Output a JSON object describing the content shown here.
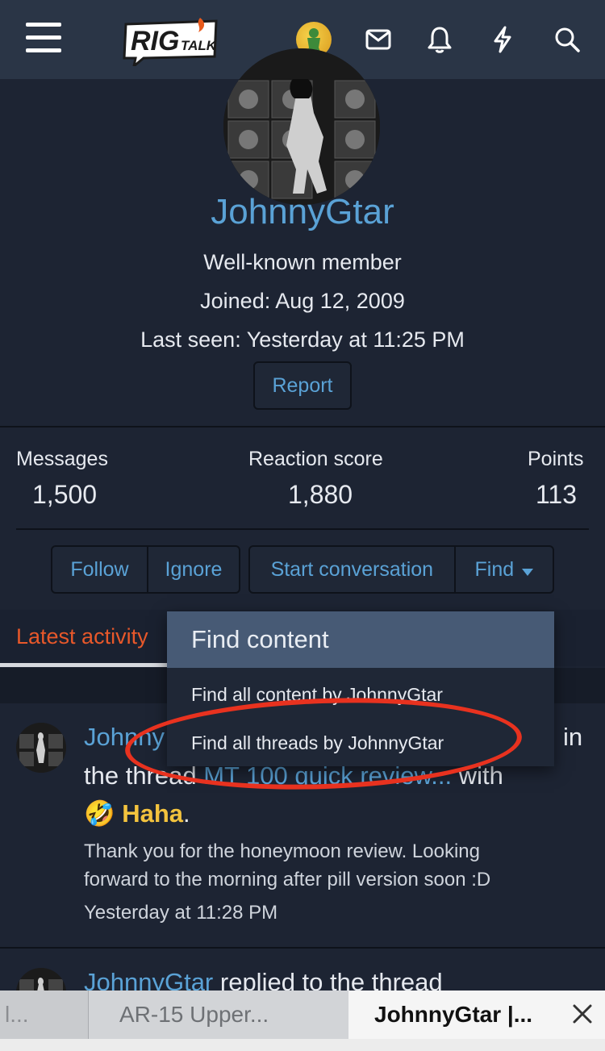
{
  "header": {
    "logo_text": "RIG TALK",
    "icons": [
      "menu-icon",
      "user-avatar",
      "mail-icon",
      "bell-icon",
      "lightning-icon",
      "search-icon"
    ]
  },
  "profile": {
    "username": "JohnnyGtar",
    "title": "Well-known member",
    "joined": "Joined: Aug 12, 2009",
    "last_seen": "Last seen: Yesterday at 11:25 PM",
    "report_label": "Report"
  },
  "stats": [
    {
      "label": "Messages",
      "value": "1,500"
    },
    {
      "label": "Reaction score",
      "value": "1,880"
    },
    {
      "label": "Points",
      "value": "113"
    }
  ],
  "actions": {
    "follow": "Follow",
    "ignore": "Ignore",
    "start_conversation": "Start conversation",
    "find": "Find"
  },
  "tabs": {
    "latest_activity": "Latest activity"
  },
  "dropdown": {
    "header": "Find content",
    "items": [
      "Find all content by JohnnyGtar",
      "Find all threads by JohnnyGtar"
    ]
  },
  "activity": [
    {
      "line1_user": "Johnny",
      "line1_tail": "in",
      "line2_prefix": "the thread ",
      "line2_link": "MT 100 quick review...",
      "line2_suffix": " with",
      "reaction_emoji": "🤣",
      "reaction": "Haha",
      "reaction_end": ".",
      "snippet_1": "Thank you for the honeymoon review. Looking",
      "snippet_2": "forward to the morning after pill version soon :D",
      "time": "Yesterday at 11:28 PM"
    },
    {
      "user": "JohnnyGtar",
      "text": " replied to the thread"
    }
  ],
  "browser_tabs": [
    {
      "label": "l..."
    },
    {
      "label": "AR-15 Upper..."
    },
    {
      "label": "JohnnyGtar |..."
    }
  ],
  "colors": {
    "background": "#1d2433",
    "header": "#2a3546",
    "link": "#5aa2d6",
    "accent": "#e8582a",
    "annotation": "#e8321f"
  }
}
